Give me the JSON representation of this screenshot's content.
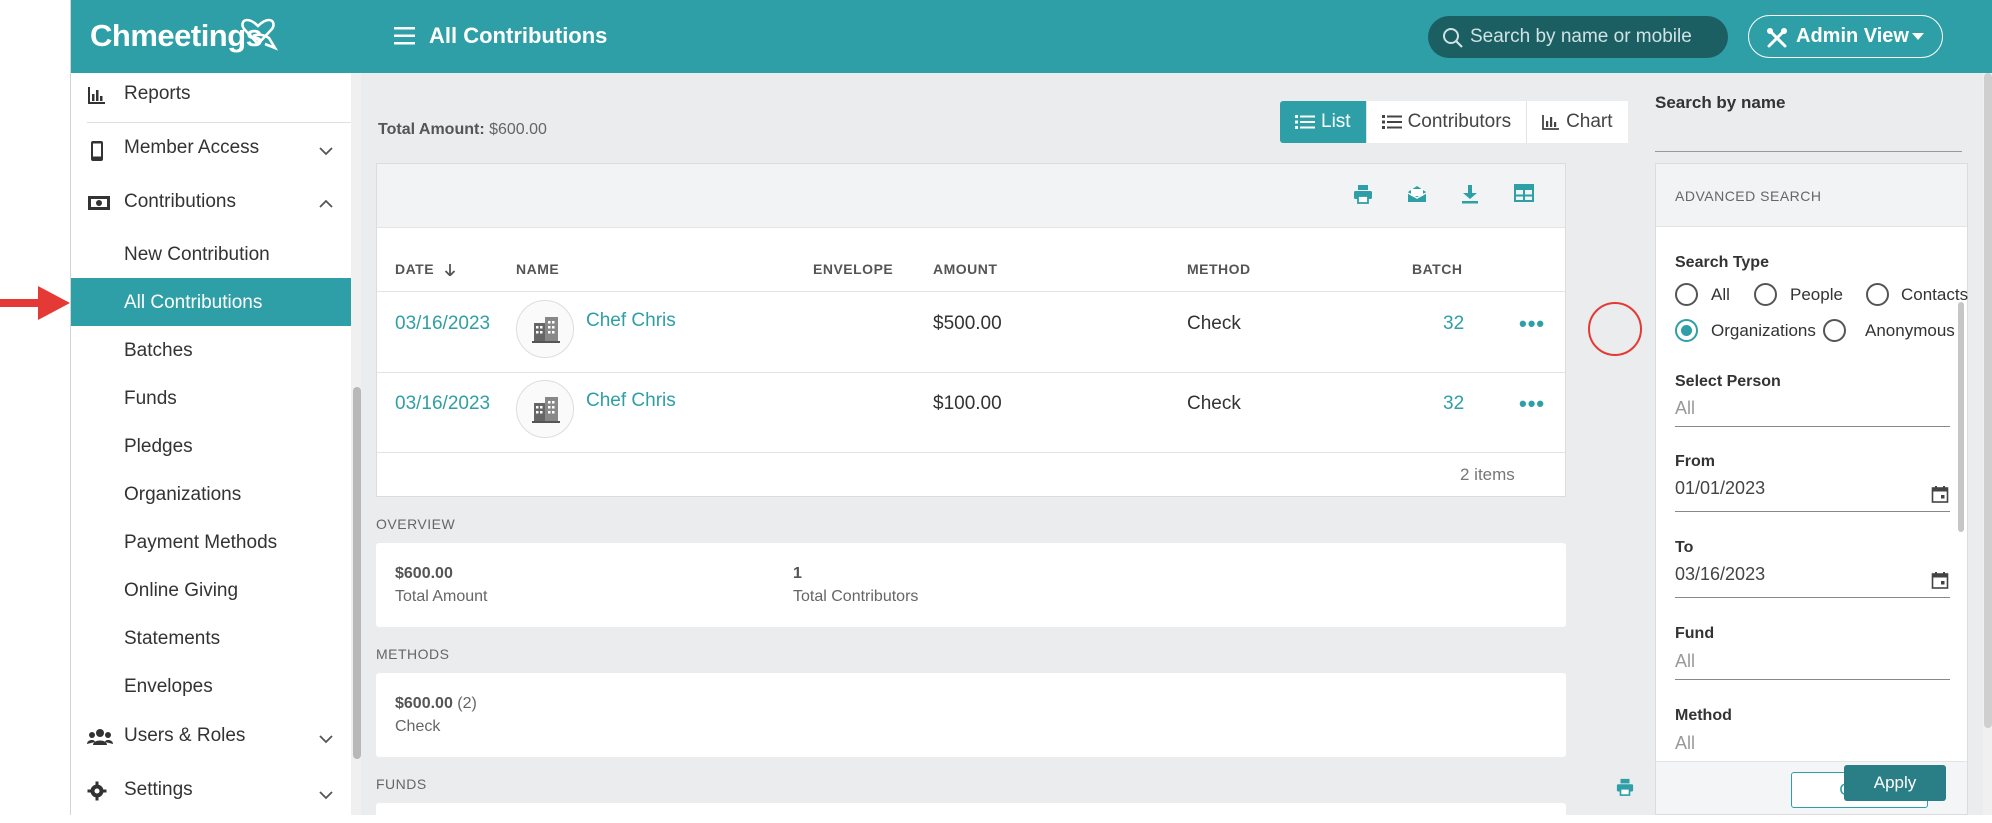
{
  "app": {
    "logo": "Chmeetings",
    "page_title": "All Contributions"
  },
  "header": {
    "search_placeholder": "Search by name or mobile",
    "admin_view_label": "Admin View"
  },
  "sidebar": {
    "items": [
      {
        "label": "Reports",
        "icon": "chart-bar-icon"
      },
      {
        "label": "Member Access",
        "icon": "phone-icon"
      },
      {
        "label": "Contributions",
        "icon": "money-icon"
      }
    ],
    "sub_items": [
      "New Contribution",
      "All Contributions",
      "Batches",
      "Funds",
      "Pledges",
      "Organizations",
      "Payment Methods",
      "Online Giving",
      "Statements",
      "Envelopes"
    ],
    "bottom_items": [
      {
        "label": "Users & Roles",
        "icon": "users-icon"
      },
      {
        "label": "Settings",
        "icon": "gear-icon"
      }
    ],
    "active": "All Contributions"
  },
  "summary": {
    "total_amount_label": "Total Amount:",
    "total_amount_value": "$600.00"
  },
  "view_toggle": {
    "list": "List",
    "contributors": "Contributors",
    "chart": "Chart"
  },
  "table": {
    "columns": [
      "DATE",
      "NAME",
      "ENVELOPE",
      "AMOUNT",
      "METHOD",
      "BATCH"
    ],
    "rows": [
      {
        "date": "03/16/2023",
        "name": "Chef Chris",
        "envelope": "",
        "amount": "$500.00",
        "method": "Check",
        "batch": "32"
      },
      {
        "date": "03/16/2023",
        "name": "Chef Chris",
        "envelope": "",
        "amount": "$100.00",
        "method": "Check",
        "batch": "32"
      }
    ],
    "row_more": "•••",
    "items_count": "2 items"
  },
  "overview": {
    "label": "OVERVIEW",
    "total_amount_value": "$600.00",
    "total_amount_label": "Total Amount",
    "total_contributors_value": "1",
    "total_contributors_label": "Total Contributors"
  },
  "methods": {
    "label": "METHODS",
    "value": "$600.00",
    "count": "(2)",
    "method": "Check"
  },
  "funds": {
    "label": "FUNDS"
  },
  "right_panel": {
    "search_by_name": "Search by name",
    "advanced_search": "ADVANCED SEARCH",
    "search_type_label": "Search Type",
    "search_types": [
      "All",
      "People",
      "Contacts",
      "Organizations",
      "Anonymous"
    ],
    "selected_search_type": "Organizations",
    "select_person_label": "Select Person",
    "select_person_value": "All",
    "from_label": "From",
    "from_value": "01/01/2023",
    "to_label": "To",
    "to_value": "03/16/2023",
    "fund_label": "Fund",
    "fund_value": "All",
    "method_label": "Method",
    "method_value": "All",
    "clear": "Clear",
    "apply": "Apply"
  },
  "colors": {
    "brand": "#2e9fa6",
    "search_bg": "#1b5f63",
    "annotation": "#e53935"
  }
}
